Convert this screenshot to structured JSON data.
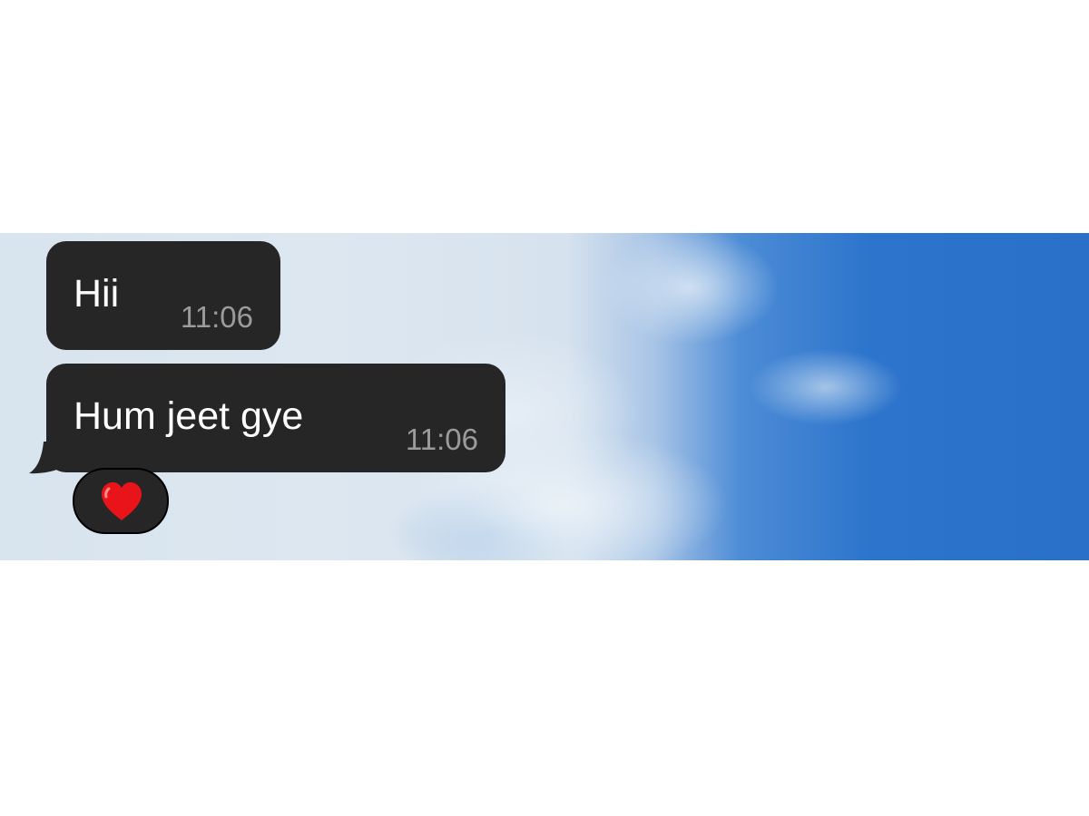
{
  "messages": [
    {
      "text": "Hii",
      "time": "11:06"
    },
    {
      "text": "Hum jeet gye",
      "time": "11:06"
    }
  ],
  "reaction": {
    "emoji": "heart-icon",
    "color": "#e8141a"
  },
  "colors": {
    "bubble": "#262626",
    "timestamp": "#9b9b9b",
    "sky_blue": "#2a70c8"
  }
}
